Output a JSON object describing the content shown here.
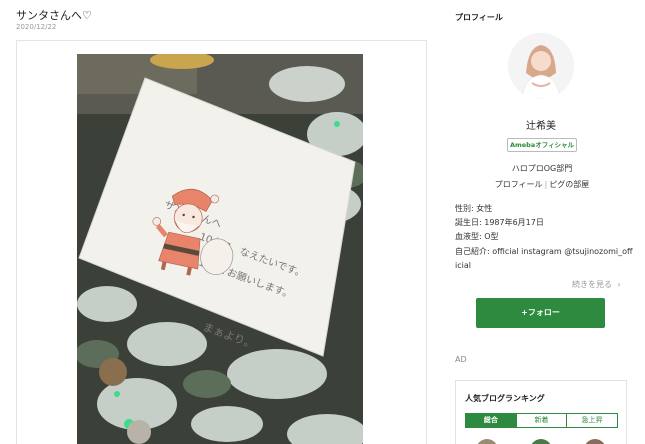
{
  "post": {
    "title": "サンタさんへ♡",
    "date": "2020/12/22"
  },
  "sidebar": {
    "heading": "プロフィール",
    "name": "辻希美",
    "badge": "Amebaオフィシャル",
    "group": "ハロプロOG部門",
    "links": [
      "プロフィール",
      "ピグの部屋"
    ],
    "info": [
      "性別: 女性",
      "誕生日: 1987年6月17日",
      "血液型: O型",
      "自己紹介: official instagram @tsujinozomi_off",
      "icial"
    ],
    "more": "続きを見る",
    "follow": "+フォロー",
    "ad": "AD",
    "ranking": {
      "title": "人気ブログランキング",
      "tabs": [
        "総合",
        "新着",
        "急上昇"
      ]
    }
  },
  "note": {
    "line1": "サンタさんへ",
    "line2": "10キロ、なえたいです。",
    "line3": "宜しくお願いします。",
    "signature": "まぁより。"
  },
  "colors": {
    "accent": "#2d8a3e",
    "text": "#333333",
    "muted": "#999999"
  }
}
